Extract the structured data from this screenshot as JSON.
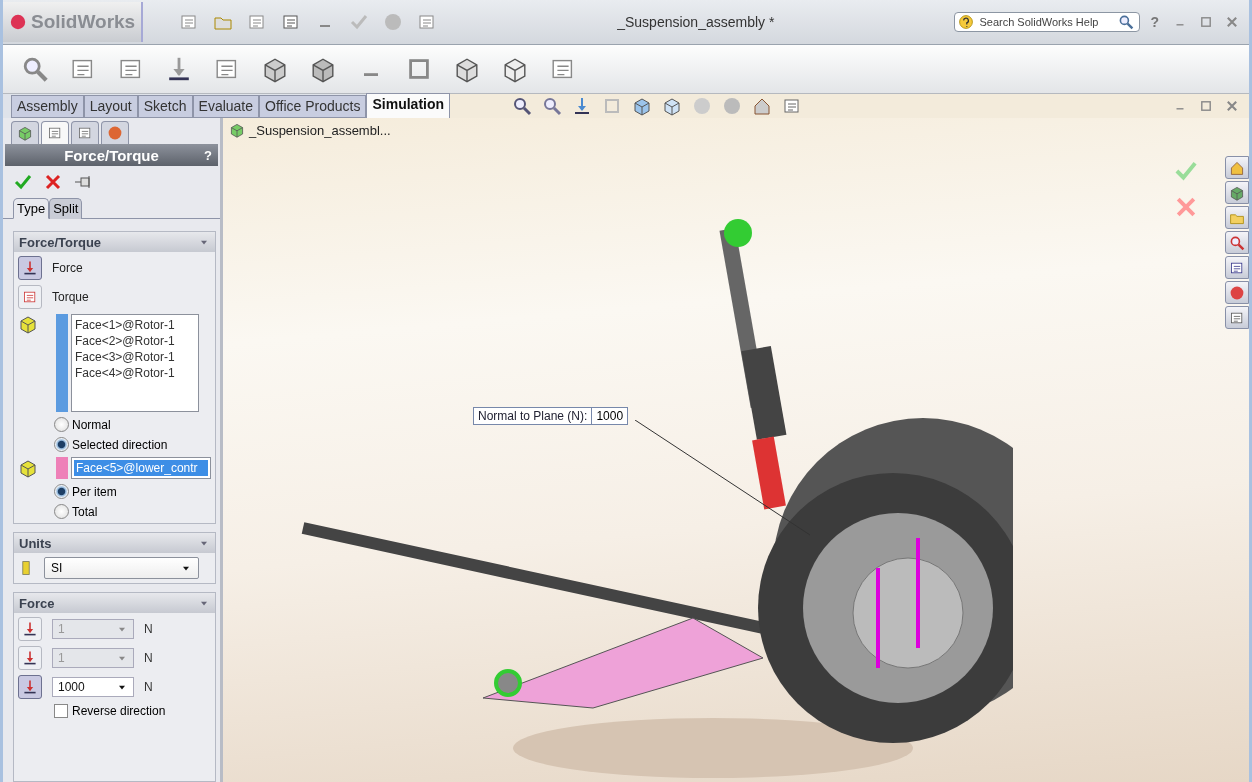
{
  "app": {
    "logo": "SolidWorks",
    "title": "_Suspension_assembly *",
    "help_search": {
      "placeholder": "Search SolidWorks Help"
    },
    "help_menu": "?"
  },
  "command_tabs": [
    {
      "label": "Assembly",
      "selected": false
    },
    {
      "label": "Layout",
      "selected": false
    },
    {
      "label": "Sketch",
      "selected": false
    },
    {
      "label": "Evaluate",
      "selected": false
    },
    {
      "label": "Office Products",
      "selected": false
    },
    {
      "label": "Simulation",
      "selected": true
    }
  ],
  "manager_tabs": [
    {
      "selected": false
    },
    {
      "selected": true
    },
    {
      "selected": false
    },
    {
      "selected": false
    }
  ],
  "property_manager": {
    "title": "Force/Torque",
    "help": "?",
    "subtabs": [
      {
        "label": "Type",
        "selected": true
      },
      {
        "label": "Split",
        "selected": false
      }
    ],
    "force_torque": {
      "title": "Force/Torque",
      "options": [
        {
          "label": "Force",
          "selected": true
        },
        {
          "label": "Torque",
          "selected": false
        }
      ],
      "faces": [
        "Face<1>@Rotor-1",
        "Face<2>@Rotor-1",
        "Face<3>@Rotor-1",
        "Face<4>@Rotor-1"
      ],
      "direction": [
        {
          "label": "Normal",
          "selected": false
        },
        {
          "label": "Selected direction",
          "selected": true
        }
      ],
      "direction_reference": "Face<5>@lower_contr",
      "distribution": [
        {
          "label": "Per item",
          "selected": true
        },
        {
          "label": "Total",
          "selected": false
        }
      ]
    },
    "units": {
      "title": "Units",
      "value": "SI"
    },
    "force": {
      "title": "Force",
      "components": [
        {
          "value": "1",
          "unit": "N",
          "disabled": true
        },
        {
          "value": "1",
          "unit": "N",
          "disabled": true
        },
        {
          "value": "1000",
          "unit": "N",
          "disabled": false
        }
      ],
      "reverse": {
        "label": "Reverse direction",
        "checked": false
      }
    }
  },
  "viewport": {
    "tree_root": "_Suspension_assembl...",
    "callout": {
      "label": "Normal to Plane (N):",
      "value": "1000"
    }
  }
}
